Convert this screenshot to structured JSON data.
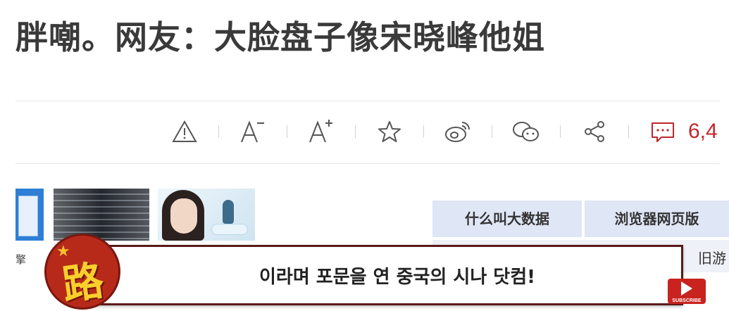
{
  "article": {
    "headline": "胖嘲。网友：大脸盘子像宋晓峰他姐"
  },
  "toolbar": {
    "icons": [
      "warning-icon",
      "font-decrease-icon",
      "font-increase-icon",
      "star-icon",
      "weibo-icon",
      "wechat-icon",
      "share-icon",
      "comment-icon"
    ],
    "comment_count": "6,4"
  },
  "left_caption": "擎",
  "hot_search": {
    "items": [
      "什么叫大数据",
      "浏览器网页版"
    ],
    "row2_partial": "旧游"
  },
  "video_overlay": {
    "subtitle": "이라며 포문을 연 중국의 시나 닷컴!",
    "logo_char": "路",
    "subscribe_label": "SUBSCRIBE"
  },
  "colors": {
    "accent_red": "#c0262c",
    "hot_cell_bg": "#dfe6f5",
    "subtitle_border": "#5a1a1a"
  }
}
